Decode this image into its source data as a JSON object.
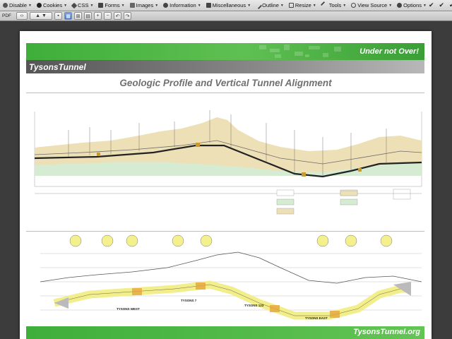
{
  "toolbar": {
    "items": [
      {
        "label": "Disable",
        "icon": "disable-icon"
      },
      {
        "label": "Cookies",
        "icon": "cookie-icon"
      },
      {
        "label": "CSS",
        "icon": "css-icon"
      },
      {
        "label": "Forms",
        "icon": "forms-icon"
      },
      {
        "label": "Images",
        "icon": "images-icon"
      },
      {
        "label": "Information",
        "icon": "information-icon"
      },
      {
        "label": "Miscellaneous",
        "icon": "miscellaneous-icon"
      },
      {
        "label": "Outline",
        "icon": "outline-icon"
      },
      {
        "label": "Resize",
        "icon": "resize-icon"
      },
      {
        "label": "Tools",
        "icon": "tools-icon"
      },
      {
        "label": "View Source",
        "icon": "view-source-icon"
      },
      {
        "label": "Options",
        "icon": "options-icon"
      }
    ],
    "status_glyphs": [
      "✔",
      "✔",
      "✔"
    ]
  },
  "pdfbar": {
    "label": "PDF"
  },
  "document": {
    "slogan": "Under not Over!",
    "brand": "TysonsTunnel",
    "title": "Geologic Profile and Vertical Tunnel Alignment",
    "footer_url": "TysonsTunnel.org",
    "stations": [
      "TYSONS WEST",
      "TYSONS 7",
      "TYSONS 123",
      "TYSONS EAST"
    ],
    "colors": {
      "brand_green": "#3fae3a",
      "tunnel_yellow": "#f2ee8c",
      "soil_green": "#d5ebd2",
      "soil_tan": "#eee0b6"
    }
  }
}
